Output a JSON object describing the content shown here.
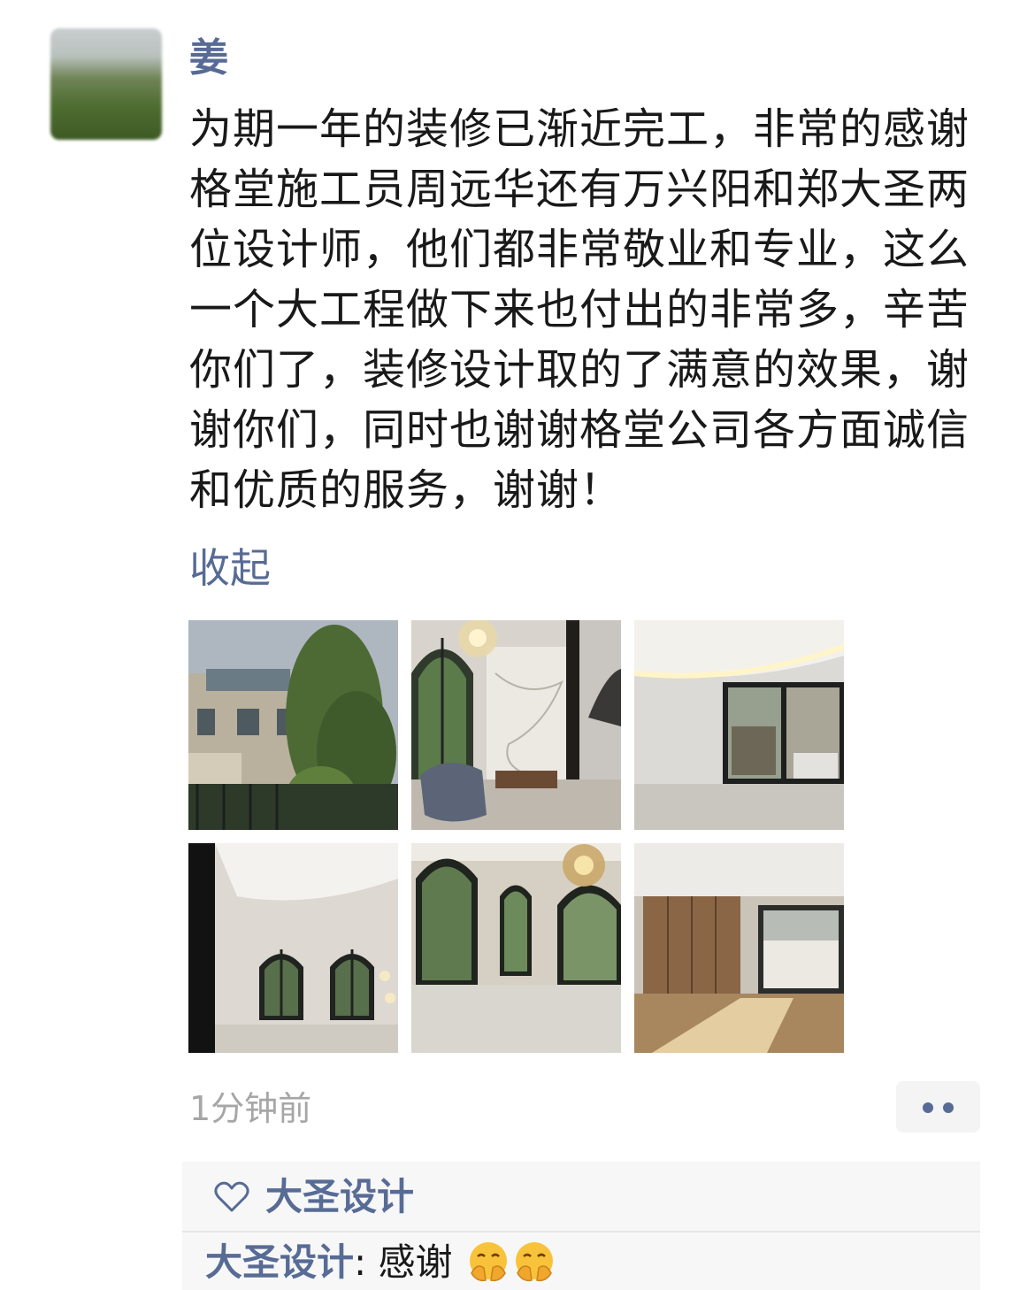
{
  "post": {
    "author": "姜",
    "text": "为期一年的装修已渐近完工，非常的感谢格堂施工员周远华还有万兴阳和郑大圣两位设计师，他们都非常敬业和专业，这么一个大工程做下来也付出的非常多，辛苦你们了，装修设计取的了满意的效果，谢谢你们，同时也谢谢格堂公司各方面诚信和优质的服务，谢谢！",
    "collapse_label": "收起",
    "timestamp": "1分钟前",
    "photos": [
      {
        "subject": "villa-exterior-with-tree"
      },
      {
        "subject": "living-room-with-chandelier-and-marble-wall"
      },
      {
        "subject": "room-with-large-window"
      },
      {
        "subject": "hall-with-arched-windows"
      },
      {
        "subject": "living-room-arched-windows-chandelier"
      },
      {
        "subject": "room-with-wood-wardrobe-sunlight"
      }
    ]
  },
  "interaction": {
    "likes": [
      "大圣设计"
    ],
    "comments": [
      {
        "author": "大圣设计",
        "separator": ": ",
        "text": "感谢",
        "emoji": [
          "smiling-face-with-hands-over-mouth",
          "smiling-face-with-hands-over-mouth"
        ]
      }
    ]
  },
  "icons": {
    "like": "heart-icon",
    "more": "more-dots-icon",
    "comment_emoji": "hug-emoji-icon"
  },
  "colors": {
    "link": "#576b95",
    "text": "#191919",
    "timestamp": "#a6a6a6",
    "interaction_bg": "#f7f7f7"
  }
}
